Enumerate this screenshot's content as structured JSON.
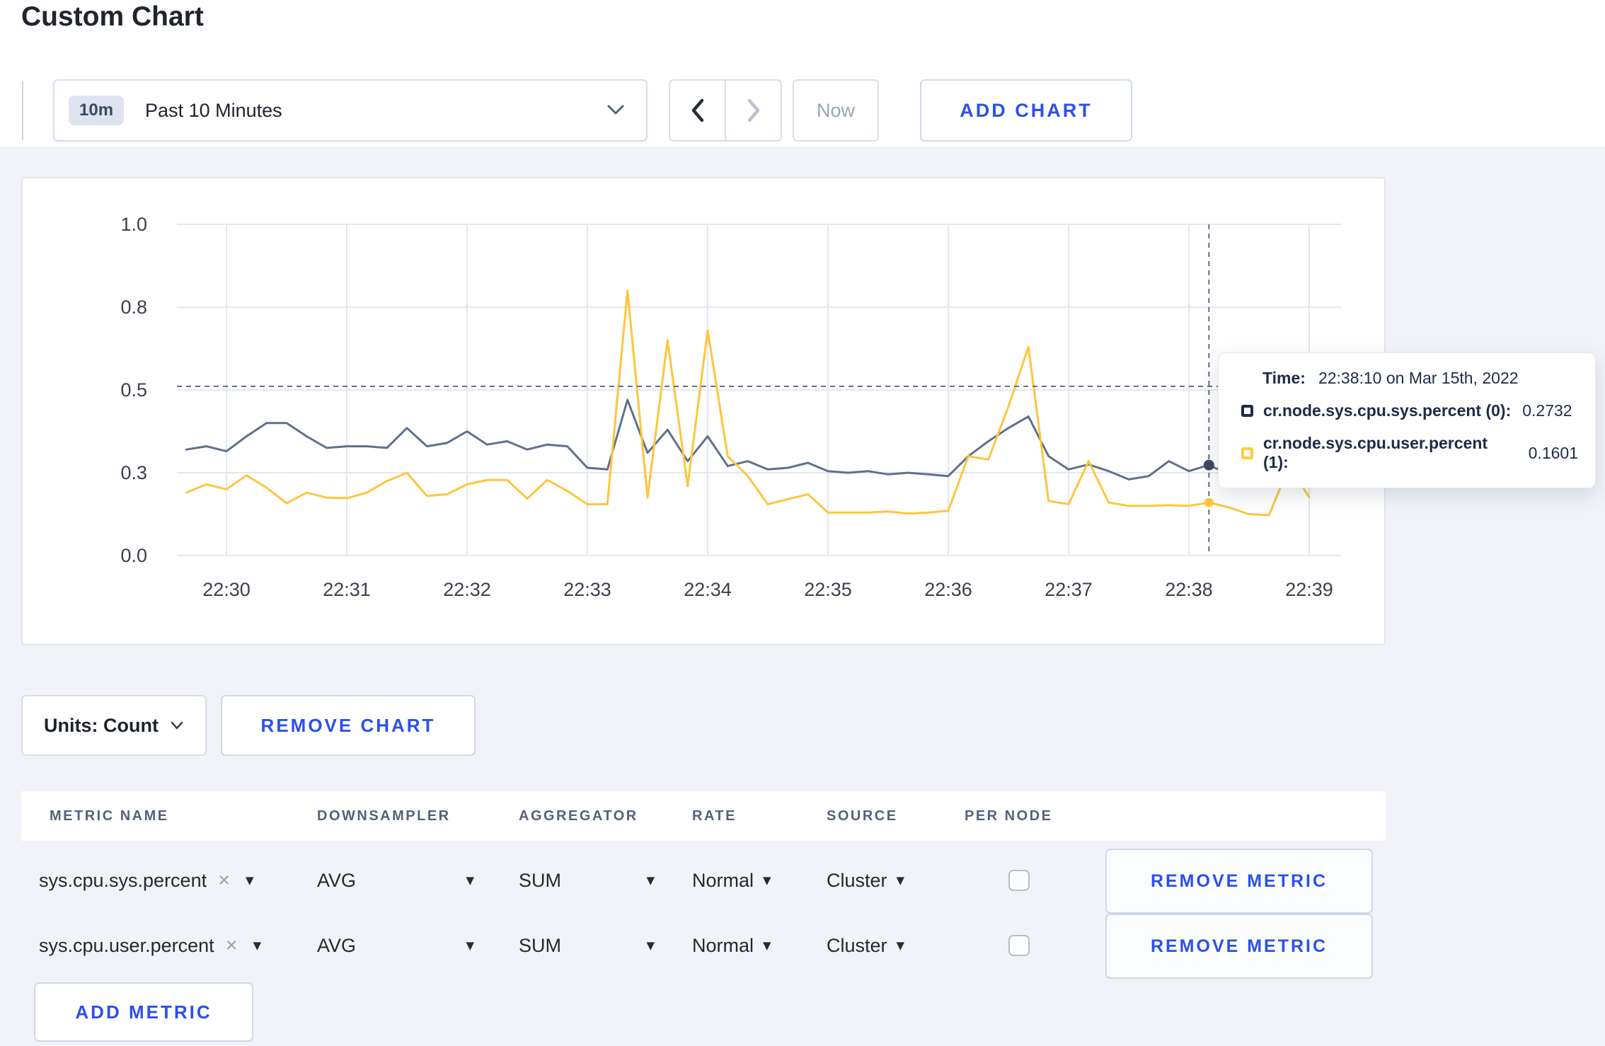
{
  "page": {
    "title": "Custom Chart",
    "background": "#f1f3f8",
    "accent_blue": "#2b50ed"
  },
  "toolbar": {
    "time_range": {
      "badge": "10m",
      "label": "Past 10 Minutes"
    },
    "prev_icon": "chevron-left",
    "next_icon": "chevron-right",
    "now_label": "Now",
    "add_chart_label": "ADD CHART"
  },
  "chart": {
    "tooltip": {
      "time_label": "Time:",
      "time_value": "22:38:10 on Mar 15th, 2022",
      "series": [
        {
          "label": "cr.node.sys.cpu.sys.percent (0):",
          "value": "0.2732",
          "color": "#1b2b4d"
        },
        {
          "label": "cr.node.sys.cpu.user.percent (1):",
          "value": "0.1601",
          "color": "#ffcd3d"
        }
      ]
    }
  },
  "chart_data": {
    "type": "line",
    "title": "",
    "xlabel": "",
    "ylabel": "",
    "ylim": [
      0,
      1
    ],
    "grid": true,
    "legend_position": "tooltip",
    "x_ticks": [
      "22:30",
      "22:31",
      "22:32",
      "22:33",
      "22:34",
      "22:35",
      "22:36",
      "22:37",
      "22:38",
      "22:39"
    ],
    "y_ticks": [
      {
        "label": "0.0",
        "value": 0
      },
      {
        "label": "0.3",
        "value": 0.25
      },
      {
        "label": "0.5",
        "value": 0.5
      },
      {
        "label": "0.8",
        "value": 0.75
      },
      {
        "label": "1.0",
        "value": 1
      }
    ],
    "x_start_offset_sec": -20,
    "point_interval_sec": 10,
    "series": [
      {
        "name": "cr.node.sys.cpu.sys.percent (0)",
        "color": "#60708c",
        "values": [
          0.32,
          0.33,
          0.315,
          0.36,
          0.4,
          0.4,
          0.36,
          0.325,
          0.33,
          0.33,
          0.325,
          0.385,
          0.33,
          0.34,
          0.375,
          0.335,
          0.345,
          0.32,
          0.335,
          0.33,
          0.265,
          0.26,
          0.47,
          0.31,
          0.38,
          0.285,
          0.36,
          0.27,
          0.285,
          0.26,
          0.265,
          0.28,
          0.255,
          0.25,
          0.255,
          0.245,
          0.25,
          0.245,
          0.24,
          0.3,
          0.345,
          0.385,
          0.42,
          0.3,
          0.26,
          0.275,
          0.255,
          0.23,
          0.24,
          0.285,
          0.255,
          0.2732,
          0.245,
          0.26,
          0.27,
          0.28,
          0.27
        ]
      },
      {
        "name": "cr.node.sys.cpu.user.percent (1)",
        "color": "#ffc53d",
        "values": [
          0.19,
          0.215,
          0.2,
          0.242,
          0.205,
          0.158,
          0.19,
          0.175,
          0.173,
          0.19,
          0.225,
          0.25,
          0.18,
          0.185,
          0.215,
          0.228,
          0.228,
          0.172,
          0.228,
          0.195,
          0.155,
          0.155,
          0.8,
          0.175,
          0.65,
          0.21,
          0.68,
          0.3,
          0.24,
          0.155,
          0.17,
          0.185,
          0.13,
          0.13,
          0.13,
          0.133,
          0.127,
          0.13,
          0.135,
          0.3,
          0.29,
          0.45,
          0.63,
          0.165,
          0.155,
          0.285,
          0.16,
          0.15,
          0.15,
          0.152,
          0.15,
          0.1601,
          0.145,
          0.125,
          0.122,
          0.27,
          0.176
        ]
      }
    ],
    "crosshair": {
      "x_time": "22:38:10",
      "x_offset_sec": 490,
      "y_value": 0.511,
      "points": [
        0.2732,
        0.1601
      ]
    }
  },
  "units_row": {
    "units_label": "Units: Count",
    "remove_chart_label": "REMOVE CHART"
  },
  "metrics_table": {
    "headers": [
      "METRIC NAME",
      "DOWNSAMPLER",
      "AGGREGATOR",
      "RATE",
      "SOURCE",
      "PER NODE"
    ],
    "rows": [
      {
        "metric": "sys.cpu.sys.percent",
        "downsampler": "AVG",
        "aggregator": "SUM",
        "rate": "Normal",
        "source": "Cluster",
        "per_node_checked": false,
        "remove_label": "REMOVE METRIC"
      },
      {
        "metric": "sys.cpu.user.percent",
        "downsampler": "AVG",
        "aggregator": "SUM",
        "rate": "Normal",
        "source": "Cluster",
        "per_node_checked": false,
        "remove_label": "REMOVE METRIC"
      }
    ],
    "add_metric_label": "ADD METRIC"
  }
}
